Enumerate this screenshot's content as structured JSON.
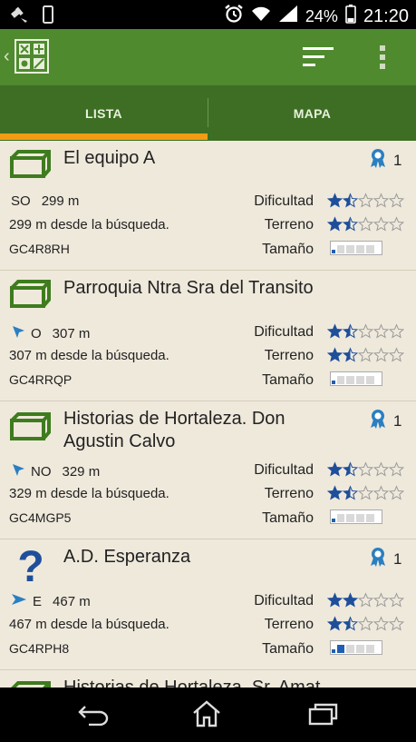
{
  "status_bar": {
    "battery": "24%",
    "time": "21:20"
  },
  "tabs": [
    {
      "label": "LISTA"
    },
    {
      "label": "MAPA"
    }
  ],
  "labels": {
    "difficulty": "Dificultad",
    "terrain": "Terreno",
    "size": "Tamaño"
  },
  "caches": [
    {
      "title": "El equipo A",
      "favorites": "1",
      "direction": "SO",
      "distance": "299 m",
      "distance_from_search": "299 m desde la búsqueda.",
      "code": "GC4R8RH",
      "difficulty": 1.5,
      "terrain": 1.5,
      "size_level": 1,
      "type": "traditional"
    },
    {
      "title": "Parroquia Ntra Sra del Transito",
      "favorites": "",
      "direction": "O",
      "distance": "307 m",
      "distance_from_search": "307 m desde la búsqueda.",
      "code": "GC4RRQP",
      "difficulty": 1.5,
      "terrain": 1.5,
      "size_level": 1,
      "type": "traditional"
    },
    {
      "title": "Historias de Hortaleza. Don Agustin Calvo",
      "favorites": "1",
      "direction": "NO",
      "distance": "329 m",
      "distance_from_search": "329 m desde la búsqueda.",
      "code": "GC4MGP5",
      "difficulty": 1.5,
      "terrain": 1.5,
      "size_level": 1,
      "type": "traditional"
    },
    {
      "title": "A.D. Esperanza",
      "favorites": "1",
      "direction": "E",
      "distance": "467 m",
      "distance_from_search": "467 m desde la búsqueda.",
      "code": "GC4RPH8",
      "difficulty": 2,
      "terrain": 1.5,
      "size_level": 2,
      "type": "mystery"
    },
    {
      "title": "Historias de Hortaleza. Sr. Amat",
      "type": "traditional"
    }
  ]
}
